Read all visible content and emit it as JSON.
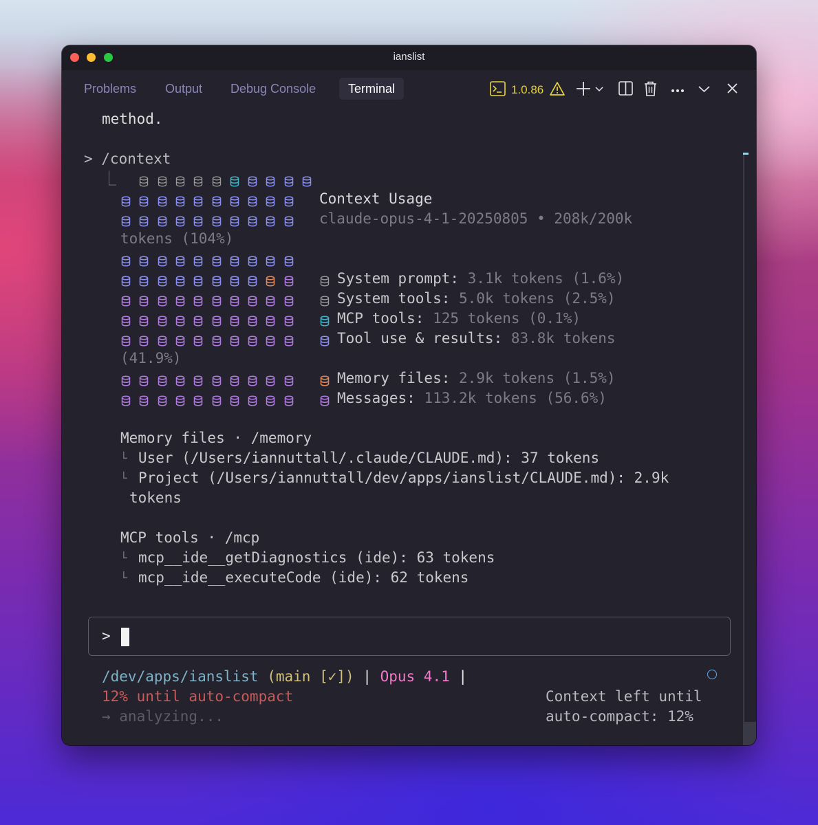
{
  "window": {
    "title": "ianslist"
  },
  "panel": {
    "tabs": [
      {
        "label": "Problems"
      },
      {
        "label": "Output"
      },
      {
        "label": "Debug Console"
      },
      {
        "label": "Terminal"
      }
    ],
    "version": "1.0.86",
    "icons": [
      "terminal-icon",
      "warning-icon",
      "plus-icon",
      "chevron-down-icon",
      "split-icon",
      "trash-icon",
      "more-icon",
      "collapse-icon",
      "close-icon"
    ]
  },
  "terminal": {
    "prev_line": "method.",
    "command": "> /context",
    "tree_corner": "⎿",
    "context": {
      "heading": "Context Usage",
      "model": "claude-opus-4-1-20250805 • 208k/200k",
      "tokens_wrap": "tokens (104%)",
      "legend": [
        {
          "label": "System prompt:",
          "value": " 3.1k tokens (1.6%)",
          "color": "#9a9a9a"
        },
        {
          "label": "System tools:",
          "value": " 5.0k tokens (2.5%)",
          "color": "#9a9a9a"
        },
        {
          "label": "MCP tools:",
          "value": " 125 tokens (0.1%)",
          "color": "#3cb6c8"
        },
        {
          "label": "Tool use & results:",
          "value": " 83.8k tokens",
          "color": "#8a8ef0"
        },
        {
          "label": "Memory files:",
          "value": " 2.9k tokens (1.5%)",
          "color": "#e0885a"
        },
        {
          "label": "Messages:",
          "value": " 113.2k tokens (56.6%)",
          "color": "#b07ae0"
        }
      ],
      "legend_wrap": "(41.9%)",
      "grid_colors": {
        "system": "#9a9a9a",
        "mcp": "#3cb6c8",
        "tool": "#8a8ef0",
        "memory": "#e0885a",
        "messages": "#b07ae0"
      }
    },
    "memory": {
      "heading": "Memory files · /memory",
      "items": [
        "User (/Users/iannuttall/.claude/CLAUDE.md): 37 tokens",
        "Project (/Users/iannuttall/dev/apps/ianslist/CLAUDE.md): 2.9k"
      ],
      "wrap": "tokens"
    },
    "mcp": {
      "heading": "MCP tools · /mcp",
      "items": [
        "mcp__ide__getDiagnostics (ide): 63 tokens",
        "mcp__ide__executeCode (ide): 62 tokens"
      ]
    },
    "prompt": ">",
    "status": {
      "path": "/dev/apps/ianslist",
      "branch": " (main [✓])",
      "sep1": " | ",
      "model": "Opus 4.1",
      "sep2": " |",
      "compact": "12% until auto-compact",
      "analyzing": "→ analyzing...",
      "right1": "Context left until",
      "right2": "auto-compact: 12%"
    }
  }
}
